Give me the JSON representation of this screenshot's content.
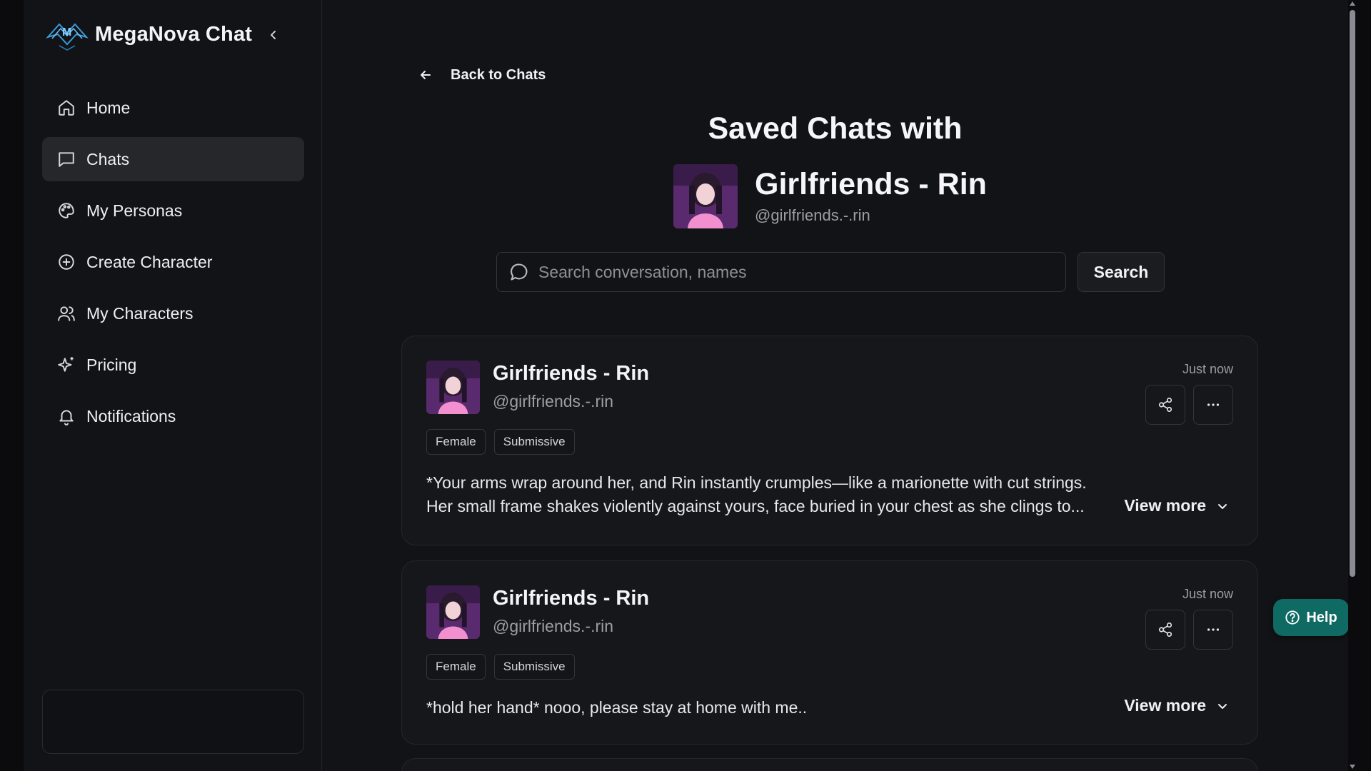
{
  "app": {
    "name": "MegaNova Chat"
  },
  "sidebar": {
    "items": [
      {
        "label": "Home",
        "icon": "home-icon",
        "active": false
      },
      {
        "label": "Chats",
        "icon": "chat-bubble-icon",
        "active": true
      },
      {
        "label": "My Personas",
        "icon": "palette-icon",
        "active": false
      },
      {
        "label": "Create Character",
        "icon": "plus-circle-icon",
        "active": false
      },
      {
        "label": "My Characters",
        "icon": "users-icon",
        "active": false
      },
      {
        "label": "Pricing",
        "icon": "sparkles-icon",
        "active": false
      },
      {
        "label": "Notifications",
        "icon": "bell-icon",
        "active": false
      }
    ]
  },
  "main": {
    "back_label": "Back to Chats",
    "title": "Saved Chats with",
    "character": {
      "name": "Girlfriends - Rin",
      "handle": "@girlfriends.-.rin"
    },
    "search": {
      "placeholder": "Search conversation, names",
      "button_label": "Search"
    }
  },
  "chats": [
    {
      "name": "Girlfriends - Rin",
      "handle": "@girlfriends.-.rin",
      "time": "Just now",
      "tags": [
        "Female",
        "Submissive"
      ],
      "text_line1": "*Your arms wrap around her, and Rin instantly crumples—like a marionette with cut strings.",
      "text_line2": "Her small frame shakes violently against yours, face buried in your chest as she clings to...",
      "view_more": "View more"
    },
    {
      "name": "Girlfriends - Rin",
      "handle": "@girlfriends.-.rin",
      "time": "Just now",
      "tags": [
        "Female",
        "Submissive"
      ],
      "text_line1": "*hold her hand* nooo, please stay at home with me..",
      "view_more": "View more"
    }
  ],
  "help": {
    "label": "Help"
  },
  "colors": {
    "background": "#121316",
    "active_nav": "#26272b",
    "help_button": "#0e6a63"
  }
}
